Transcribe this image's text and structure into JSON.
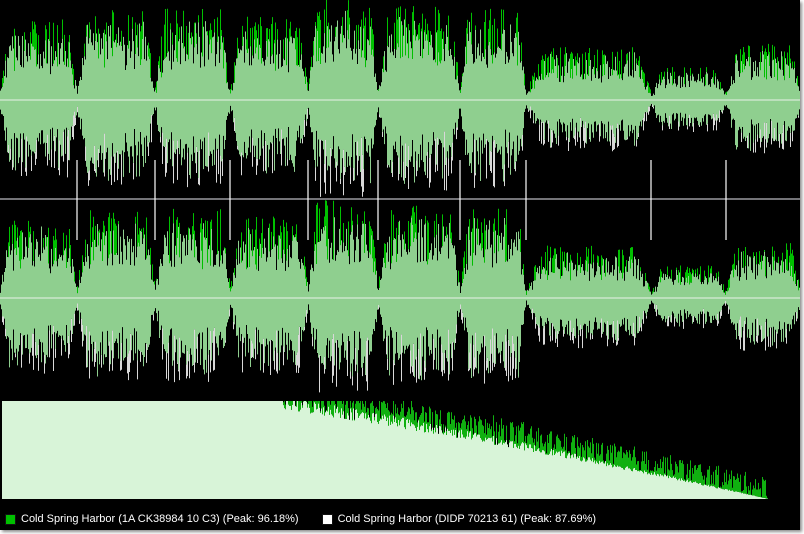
{
  "colors": {
    "background": "#000000",
    "waveform_a": "#00c000",
    "waveform_b": "#d8d8d8",
    "overlap": "#8fcf8f",
    "spectrum_fill": "#d8f4d8",
    "divider": "#a0a0a0"
  },
  "waveform": {
    "channels": 2,
    "segment_dividers": 9,
    "comparison": "overlay"
  },
  "legend": {
    "item_a": {
      "label": "Cold Spring Harbor (1A CK38984 10 C3) (Peak: 96.18%)",
      "color": "#00c000"
    },
    "item_b": {
      "label": "Cold Spring Harbor (DIDP 70213 61) (Peak: 87.69%)",
      "color": "#ffffff"
    }
  }
}
